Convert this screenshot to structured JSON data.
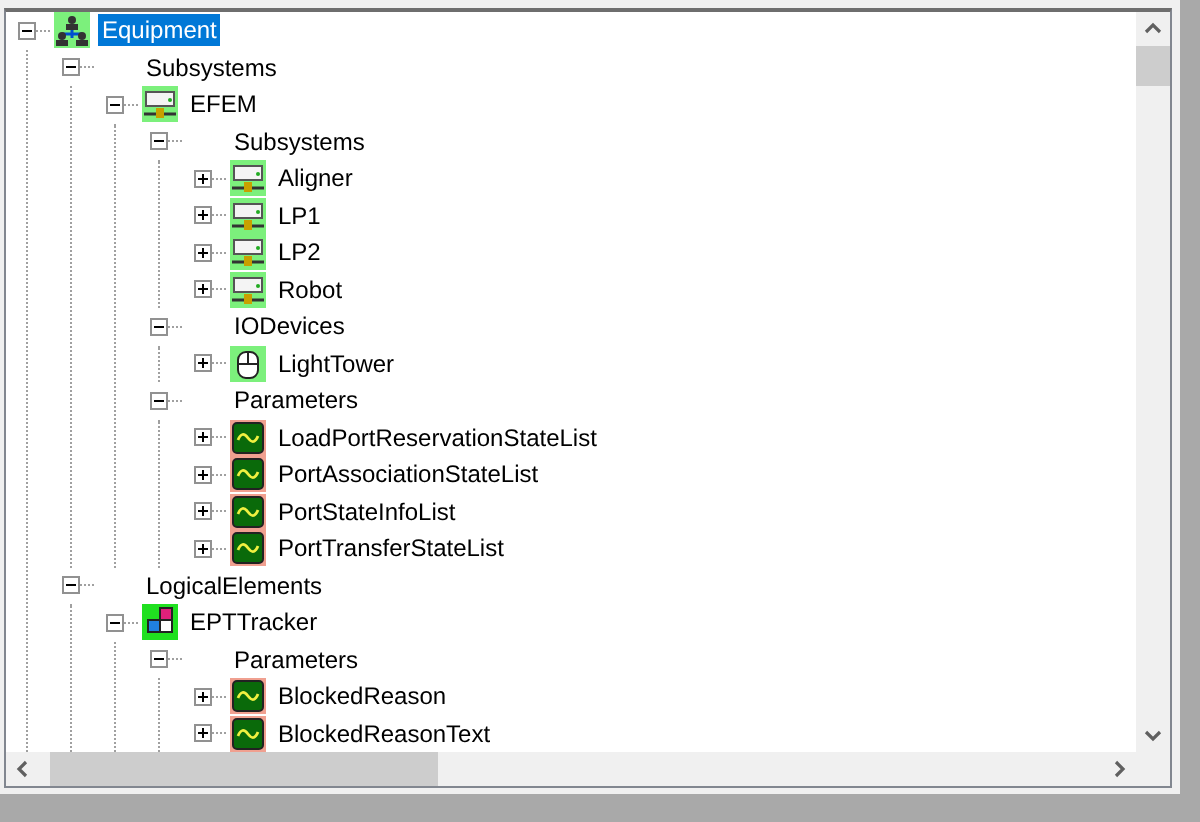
{
  "tree": [
    {
      "label": "Equipment",
      "kind": "network",
      "expanded": true,
      "selected": true,
      "children": [
        {
          "label": "Subsystems",
          "kind": "folder",
          "expanded": true,
          "selected": false,
          "children": [
            {
              "label": "EFEM",
              "kind": "device",
              "expanded": true,
              "selected": false,
              "children": [
                {
                  "label": "Subsystems",
                  "kind": "folder",
                  "expanded": true,
                  "selected": false,
                  "children": [
                    {
                      "label": "Aligner",
                      "kind": "device",
                      "expanded": false,
                      "selected": false
                    },
                    {
                      "label": "LP1",
                      "kind": "device",
                      "expanded": false,
                      "selected": false
                    },
                    {
                      "label": "LP2",
                      "kind": "device",
                      "expanded": false,
                      "selected": false
                    },
                    {
                      "label": "Robot",
                      "kind": "device",
                      "expanded": false,
                      "selected": false
                    }
                  ]
                },
                {
                  "label": "IODevices",
                  "kind": "folder",
                  "expanded": true,
                  "selected": false,
                  "children": [
                    {
                      "label": "LightTower",
                      "kind": "mouse",
                      "expanded": false,
                      "selected": false
                    }
                  ]
                },
                {
                  "label": "Parameters",
                  "kind": "folder",
                  "expanded": true,
                  "selected": false,
                  "children": [
                    {
                      "label": "LoadPortReservationStateList",
                      "kind": "parameter",
                      "expanded": false,
                      "selected": false
                    },
                    {
                      "label": "PortAssociationStateList",
                      "kind": "parameter",
                      "expanded": false,
                      "selected": false
                    },
                    {
                      "label": "PortStateInfoList",
                      "kind": "parameter",
                      "expanded": false,
                      "selected": false
                    },
                    {
                      "label": "PortTransferStateList",
                      "kind": "parameter",
                      "expanded": false,
                      "selected": false
                    }
                  ]
                }
              ]
            }
          ]
        },
        {
          "label": "LogicalElements",
          "kind": "folder",
          "expanded": true,
          "selected": false,
          "children": [
            {
              "label": "EPTTracker",
              "kind": "element",
              "expanded": true,
              "selected": false,
              "children": [
                {
                  "label": "Parameters",
                  "kind": "folder",
                  "expanded": true,
                  "selected": false,
                  "children": [
                    {
                      "label": "BlockedReason",
                      "kind": "parameter",
                      "expanded": false,
                      "selected": false
                    },
                    {
                      "label": "BlockedReasonText",
                      "kind": "parameter",
                      "expanded": false,
                      "selected": false
                    }
                  ]
                }
              ]
            }
          ]
        }
      ]
    }
  ]
}
